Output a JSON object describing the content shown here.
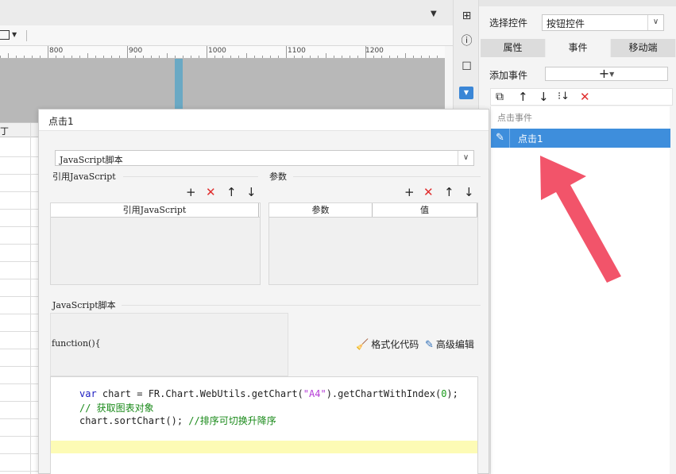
{
  "ruler": {
    "marks": [
      "800",
      "900",
      "1000",
      "1100",
      "1200"
    ]
  },
  "sheet": {
    "header_text": "丁"
  },
  "right_panel": {
    "select_control_label": "选择控件",
    "select_control_value": "按钮控件",
    "tabs": [
      "属性",
      "事件",
      "移动端"
    ],
    "active_tab": "事件",
    "add_event_label": "添加事件",
    "add_event_symbol": "+",
    "event_group": "点击事件",
    "event_item": "点击1"
  },
  "dialog": {
    "title": "点击1",
    "type_value": "JavaScript脚本",
    "ref_section_label": "引用JavaScript",
    "params_section_label": "参数",
    "ref_table_header": "引用JavaScript",
    "params_table_headers": [
      "参数",
      "值"
    ],
    "script_section_label": "JavaScript脚本",
    "function_header": "function(){",
    "format_button": "格式化代码",
    "advanced_edit_button": "高级编辑",
    "code_lines": [
      {
        "parts": [
          {
            "t": "var",
            "c": "kw"
          },
          {
            "t": " chart = FR.Chart.WebUtils.getChart(",
            "c": ""
          },
          {
            "t": "\"A4\"",
            "c": "str"
          },
          {
            "t": ").getChartWithIndex(",
            "c": ""
          },
          {
            "t": "0",
            "c": "num"
          },
          {
            "t": ");",
            "c": ""
          }
        ]
      },
      {
        "parts": [
          {
            "t": "// 获取图表对象",
            "c": "cm"
          }
        ]
      },
      {
        "parts": [
          {
            "t": "chart.sortChart(); ",
            "c": ""
          },
          {
            "t": "//排序可切换升降序",
            "c": "cm"
          }
        ]
      }
    ]
  },
  "colors": {
    "accent_blue": "#3e8edc",
    "delete_red": "#e02d2d",
    "annotation_arrow": "#f2546a",
    "highlight_line": "#fdfbb5"
  }
}
